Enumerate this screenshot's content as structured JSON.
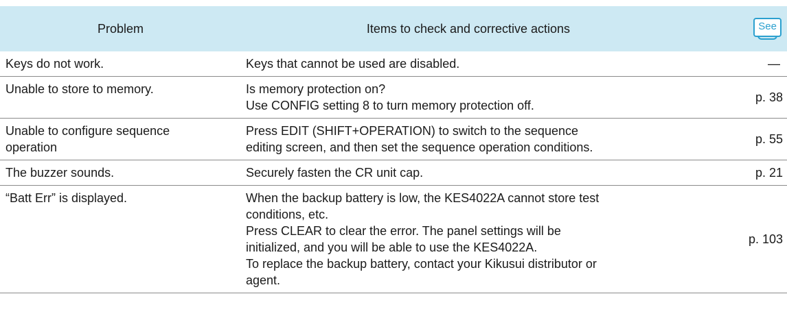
{
  "header": {
    "problem_label": "Problem",
    "actions_label": "Items to check and corrective actions",
    "see_label": "See"
  },
  "rows": [
    {
      "problem": [
        "Keys do not work."
      ],
      "actions": [
        "Keys that cannot be used are disabled."
      ],
      "ref": "—"
    },
    {
      "problem": [
        "Unable to store to memory."
      ],
      "actions": [
        "Is memory protection on?",
        "Use CONFIG setting 8 to turn memory protection off."
      ],
      "ref": "p. 38"
    },
    {
      "problem": [
        "Unable to configure sequence",
        "operation"
      ],
      "actions": [
        "Press EDIT (SHIFT+OPERATION) to switch to the sequence",
        "editing screen, and then set the sequence operation conditions."
      ],
      "ref": "p. 55"
    },
    {
      "problem": [
        "The buzzer sounds."
      ],
      "actions": [
        "Securely fasten the CR unit cap."
      ],
      "ref": "p. 21"
    },
    {
      "problem": [
        "“Batt Err” is displayed."
      ],
      "actions": [
        "When the backup battery is low, the KES4022A cannot store test",
        "conditions, etc.",
        "Press CLEAR to clear the error. The panel settings will be",
        "initialized, and you will be able to use the KES4022A.",
        "To replace the backup battery, contact your Kikusui distributor or",
        "agent."
      ],
      "ref": "p. 103"
    }
  ]
}
